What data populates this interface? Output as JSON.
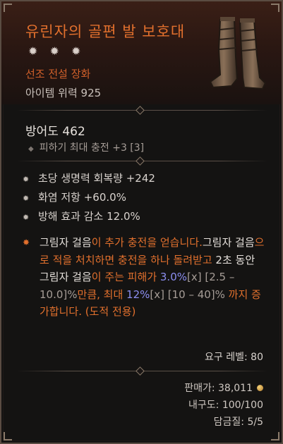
{
  "item": {
    "name": "유린자의 골편 발 보호대",
    "stars": "✹ ✹ ✹",
    "rarity": "선조 전설 장화",
    "item_power": "아이템 위력 925"
  },
  "armor": {
    "value": "방어도 462",
    "implicit": "피하기 최대 충전 +3 [3]"
  },
  "affixes": [
    "초당 생명력 회복량 +242",
    "화염 저항 +60.0%",
    "방해 효과 감소 12.0%"
  ],
  "aspect": {
    "p1": "그림자 걸음",
    "p2": "이 추가 충전을 얻습니다.",
    "p3": "그림자 걸음",
    "p4": "으로 적을 처치하면 충전을 하나 돌려받고 ",
    "p5": "2초 동안 ",
    "p6": "그림자 걸음",
    "p7": "이 주는 피해가 ",
    "p8": "3.0%",
    "p9": "[x]",
    "p10": " [2.5 – 10.0]%",
    "p11": "만큼, 최대 ",
    "p12": "12%",
    "p13": "[x]",
    "p14": " [10 – 40]%",
    "p15": " 까지 증가합니다. (도적 전용)"
  },
  "requirement": "요구 레벨: 80",
  "footer": {
    "sell": "판매가: 38,011",
    "durability": "내구도: 100/100",
    "tempers": "담금질: 5/5"
  },
  "colors": {
    "legendary_orange": "#e2702d",
    "value_blue": "#8c8ef0",
    "frame": "#5a4c42"
  },
  "icons": [
    "boots-icon",
    "star-icon",
    "diamond-bullet-icon",
    "coin-icon"
  ]
}
